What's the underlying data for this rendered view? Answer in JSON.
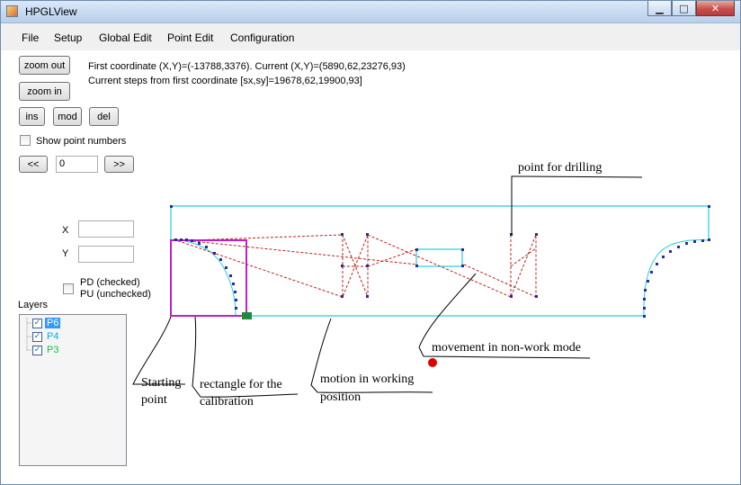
{
  "window": {
    "title": "HPGLView",
    "min_icon": "minimize-icon",
    "max_icon": "maximize-icon",
    "close_icon": "close-icon"
  },
  "menu": [
    "File",
    "Setup",
    "Global Edit",
    "Point Edit",
    "Configuration"
  ],
  "toolbar": {
    "zoom_out": "zoom out",
    "zoom_in": "zoom in",
    "ins": "ins",
    "mod": "mod",
    "del": "del",
    "prev": "<<",
    "next": ">>"
  },
  "info": {
    "line1": "First coordinate (X,Y)=(-13788,3376). Current (X,Y)=(5890,62,23276,93)",
    "line2": "Current steps from first coordinate [sx,sy]=19678,62,19900,93]"
  },
  "show_point_numbers": {
    "label": "Show point numbers",
    "checked": false
  },
  "point_index": {
    "value": "0"
  },
  "coords": {
    "x_label": "X",
    "y_label": "Y",
    "x_value": "",
    "y_value": ""
  },
  "pen": {
    "label_line1": "PD (checked)",
    "label_line2": "PU (unchecked)",
    "checked": false
  },
  "layers": {
    "title": "Layers",
    "items": [
      {
        "name": "P6",
        "checked": true,
        "color": "#000000",
        "selected": true
      },
      {
        "name": "P4",
        "checked": true,
        "color": "#00b0f0",
        "selected": false
      },
      {
        "name": "P3",
        "checked": true,
        "color": "#00cc44",
        "selected": false
      }
    ]
  },
  "annotations": {
    "drilling": "point for drilling",
    "non_work": "movement in non-work mode",
    "starting_1": "Starting",
    "starting_2": "point",
    "calibration_1": "rectangle for the",
    "calibration_2": "calibration",
    "working_1": "motion in working",
    "working_2": "position"
  },
  "colors": {
    "outline": "#22cfe0",
    "calibration": "#c21ec7",
    "non_work": "#c0201c",
    "points": "#2a2a9a",
    "marker": "#1e8a3c",
    "red_dot": "#e00000"
  }
}
